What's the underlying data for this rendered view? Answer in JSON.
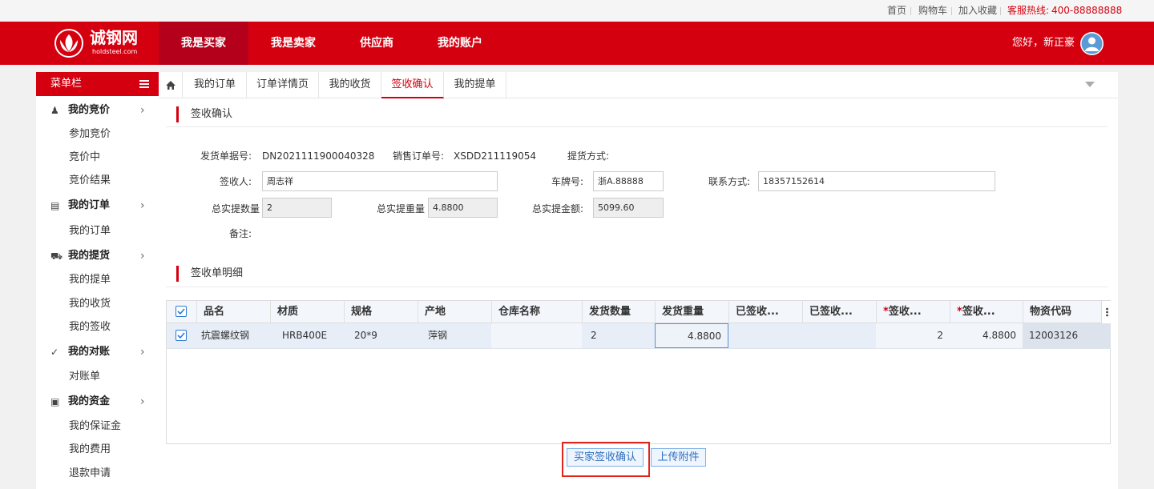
{
  "topbar": {
    "links": [
      "首页",
      "购物车",
      "加入收藏"
    ],
    "hotline_label": "客服热线:",
    "hotline": "400-88888888"
  },
  "header": {
    "logo_text": "诚钢网",
    "logo_sub": "holdsteel.com",
    "nav": [
      "我是买家",
      "我是卖家",
      "供应商",
      "我的账户"
    ],
    "greeting": "您好，新正豪"
  },
  "sidebar": {
    "title": "菜单栏",
    "groups": [
      {
        "label": "我的竞价",
        "items": [
          "参加竞价",
          "竞价中",
          "竞价结果"
        ]
      },
      {
        "label": "我的订单",
        "items": [
          "我的订单"
        ]
      },
      {
        "label": "我的提货",
        "items": [
          "我的提单",
          "我的收货",
          "我的签收"
        ]
      },
      {
        "label": "我的对账",
        "items": [
          "对账单"
        ]
      },
      {
        "label": "我的资金",
        "items": [
          "我的保证金",
          "我的费用",
          "退款申请"
        ]
      }
    ]
  },
  "tabs": [
    "我的订单",
    "订单详情页",
    "我的收货",
    "签收确认",
    "我的提单"
  ],
  "form": {
    "section_title": "签收确认",
    "delivery_no_label": "发货单据号:",
    "delivery_no": "DN2021111900040328",
    "sales_order_label": "销售订单号:",
    "sales_order": "XSDD211119054",
    "pickup_method_label": "提货方式:",
    "pickup_method": "",
    "receiver_label": "签收人:",
    "receiver": "周志祥",
    "plate_label": "车牌号:",
    "plate": "浙A.88888",
    "contact_label": "联系方式:",
    "contact": "18357152614",
    "total_qty_label": "总实提数量",
    "total_qty": "2",
    "total_weight_label": "总实提重量",
    "total_weight": "4.8800",
    "total_amount_label": "总实提金额:",
    "total_amount": "5099.60",
    "remark_label": "备注:"
  },
  "detail": {
    "section_title": "签收单明细",
    "columns": [
      "品名",
      "材质",
      "规格",
      "产地",
      "仓库名称",
      "发货数量",
      "发货重量",
      "已签收...",
      "已签收...",
      "签收...",
      "签收...",
      "物资代码"
    ],
    "rows": [
      [
        "抗震螺纹钢",
        "HRB400E",
        "20*9",
        "萍钢",
        "",
        "2",
        "4.8800",
        "",
        "",
        "2",
        "4.8800",
        "12003126"
      ]
    ]
  },
  "buttons": {
    "confirm": "买家签收确认",
    "upload": "上传附件"
  },
  "colors": {
    "brand_red": "#d5000f",
    "accent_blue": "#2f6fbd"
  }
}
